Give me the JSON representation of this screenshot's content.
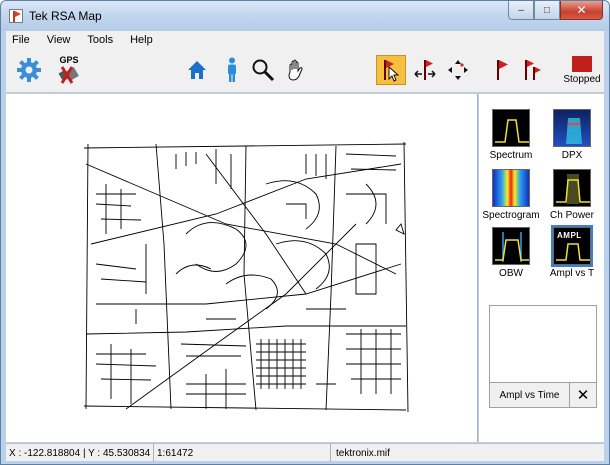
{
  "window": {
    "title": "Tek RSA Map",
    "min_glyph": "–",
    "max_glyph": "□",
    "close_glyph": "✕"
  },
  "menu": [
    "File",
    "View",
    "Tools",
    "Help"
  ],
  "toolbar": {
    "settings_icon": "gear-icon",
    "gps_label": "GPS",
    "home_icon": "home-icon",
    "person_icon": "person-icon",
    "zoom_icon": "magnifier-icon",
    "pan_icon": "hand-icon",
    "select_marker_icon": "marker-cursor-icon",
    "move_marker_icon": "marker-move-icon",
    "arrows_icon": "four-arrows-icon",
    "flag_icon": "flag-icon",
    "multi_flag_icon": "multi-flag-icon",
    "stop_label": "Stopped",
    "accent_red": "#c0201a",
    "accent_blue": "#1e7fd0",
    "highlight": "#f5c040"
  },
  "measurements": [
    {
      "label": "Spectrum"
    },
    {
      "label": "DPX"
    },
    {
      "label": "Spectrogram"
    },
    {
      "label": "Ch Power"
    },
    {
      "label": "OBW"
    },
    {
      "label": "Ampl vs T",
      "badge": "AMPL"
    }
  ],
  "mini_panel": {
    "label": "Ampl vs Time",
    "close_glyph": "✕"
  },
  "status": {
    "coords": "X : -122.818804 | Y : 45.530834",
    "scale": "1:61472",
    "file": "tektronix.mif"
  }
}
